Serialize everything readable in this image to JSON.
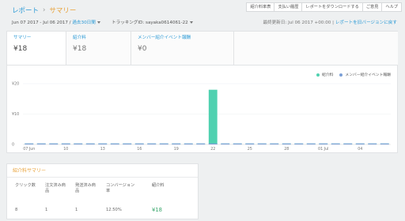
{
  "breadcrumb": {
    "root": "レポート",
    "separator": "›",
    "current": "サマリー"
  },
  "topnav": [
    "紹介料率表",
    "支払い履歴",
    "レポートをダウンロードする",
    "ご意見",
    "ヘルプ"
  ],
  "subbar": {
    "date_range": "Jun 07 2017 - Jul 06 2017 /",
    "period_link": "過去30日間",
    "tracking_label": "トラッキングID:",
    "tracking_value": "sayaka0614061-22",
    "updated_label": "最終更新日: Jul 06 2017 +00:00 |",
    "old_version_link": "レポートを旧バージョンに戻す"
  },
  "metrics": [
    {
      "label": "サマリー",
      "value": "¥18"
    },
    {
      "label": "紹介料",
      "value": "¥18"
    },
    {
      "label": "メンバー紹介イベント報酬",
      "value": "¥0"
    }
  ],
  "legend": [
    {
      "label": "紹介料",
      "color": "#4fd1b0"
    },
    {
      "label": "メンバー紹介イベント報酬",
      "color": "#7b9fd6"
    }
  ],
  "chart_data": {
    "type": "bar",
    "categories": [
      "07 Jun",
      "08",
      "09",
      "10",
      "11",
      "12",
      "13",
      "14",
      "15",
      "16",
      "17",
      "18",
      "19",
      "20",
      "21",
      "22",
      "23",
      "24",
      "25",
      "26",
      "27",
      "28",
      "29",
      "30",
      "01 Jul",
      "02",
      "03",
      "04",
      "05",
      "06"
    ],
    "x_tick_labels": [
      "07 Jun",
      "10",
      "13",
      "16",
      "19",
      "22",
      "25",
      "28",
      "01 Jul",
      "04"
    ],
    "y_tick_labels": [
      "¥20",
      "¥10",
      "0"
    ],
    "ylim": [
      0,
      20
    ],
    "series": [
      {
        "name": "紹介料",
        "values": [
          0,
          0,
          0,
          0,
          0,
          0,
          0,
          0,
          0,
          0,
          0,
          0,
          0,
          0,
          0,
          18,
          0,
          0,
          0,
          0,
          0,
          0,
          0,
          0,
          0,
          0,
          0,
          0,
          0,
          0
        ]
      },
      {
        "name": "メンバー紹介イベント報酬",
        "values": [
          0,
          0,
          0,
          0,
          0,
          0,
          0,
          0,
          0,
          0,
          0,
          0,
          0,
          0,
          0,
          0,
          0,
          0,
          0,
          0,
          0,
          0,
          0,
          0,
          0,
          0,
          0,
          0,
          0,
          0
        ]
      }
    ],
    "grid": true,
    "legend_position": "top-right"
  },
  "summary": {
    "title": "紹介料サマリー",
    "columns": [
      "クリック数",
      "注文済み商品",
      "発送済み商品",
      "コンバージョン率",
      "紹介料"
    ],
    "values": [
      "8",
      "1",
      "1",
      "12.50%",
      "¥18"
    ]
  }
}
